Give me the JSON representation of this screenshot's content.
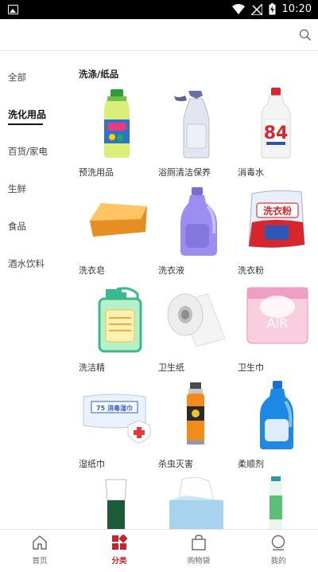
{
  "status_bar": {
    "time": "10:20"
  },
  "categories": [
    "全部",
    "洗化用品",
    "百货/家电",
    "生鲜",
    "食品",
    "酒水饮料"
  ],
  "active_category_index": 1,
  "section_title": "洗涤/纸品",
  "products": [
    {
      "name": "预洗用品",
      "icon": "prewash-bottle-icon"
    },
    {
      "name": "浴厕清洁保养",
      "icon": "toilet-cleaner-icon"
    },
    {
      "name": "消毒水",
      "icon": "disinfectant-bottle-icon"
    },
    {
      "name": "洗衣皂",
      "icon": "laundry-soap-icon"
    },
    {
      "name": "洗衣液",
      "icon": "laundry-liquid-icon"
    },
    {
      "name": "洗衣粉",
      "icon": "laundry-powder-icon"
    },
    {
      "name": "洗洁精",
      "icon": "dish-soap-icon"
    },
    {
      "name": "卫生纸",
      "icon": "toilet-paper-icon"
    },
    {
      "name": "卫生巾",
      "icon": "sanitary-pad-icon"
    },
    {
      "name": "湿纸巾",
      "icon": "wet-wipes-icon"
    },
    {
      "name": "杀虫灭害",
      "icon": "insecticide-spray-icon"
    },
    {
      "name": "柔顺剂",
      "icon": "softener-bottle-icon"
    },
    {
      "name": "",
      "icon": "cosmetic-tube-icon"
    },
    {
      "name": "",
      "icon": "tissue-box-icon"
    },
    {
      "name": "",
      "icon": "air-freshener-icon"
    }
  ],
  "product_label_texts": {
    "laundry_powder": "洗衣粉",
    "wet_wipes": "75 消毒湿巾",
    "sanitary_pad": "AiR"
  },
  "tabs": [
    {
      "label": "首页",
      "icon": "home-icon"
    },
    {
      "label": "分类",
      "icon": "category-icon"
    },
    {
      "label": "购物袋",
      "icon": "shopping-bag-icon"
    },
    {
      "label": "我的",
      "icon": "profile-icon"
    }
  ],
  "active_tab_index": 1,
  "colors": {
    "accent": "#c8232c",
    "text": "#333333"
  }
}
